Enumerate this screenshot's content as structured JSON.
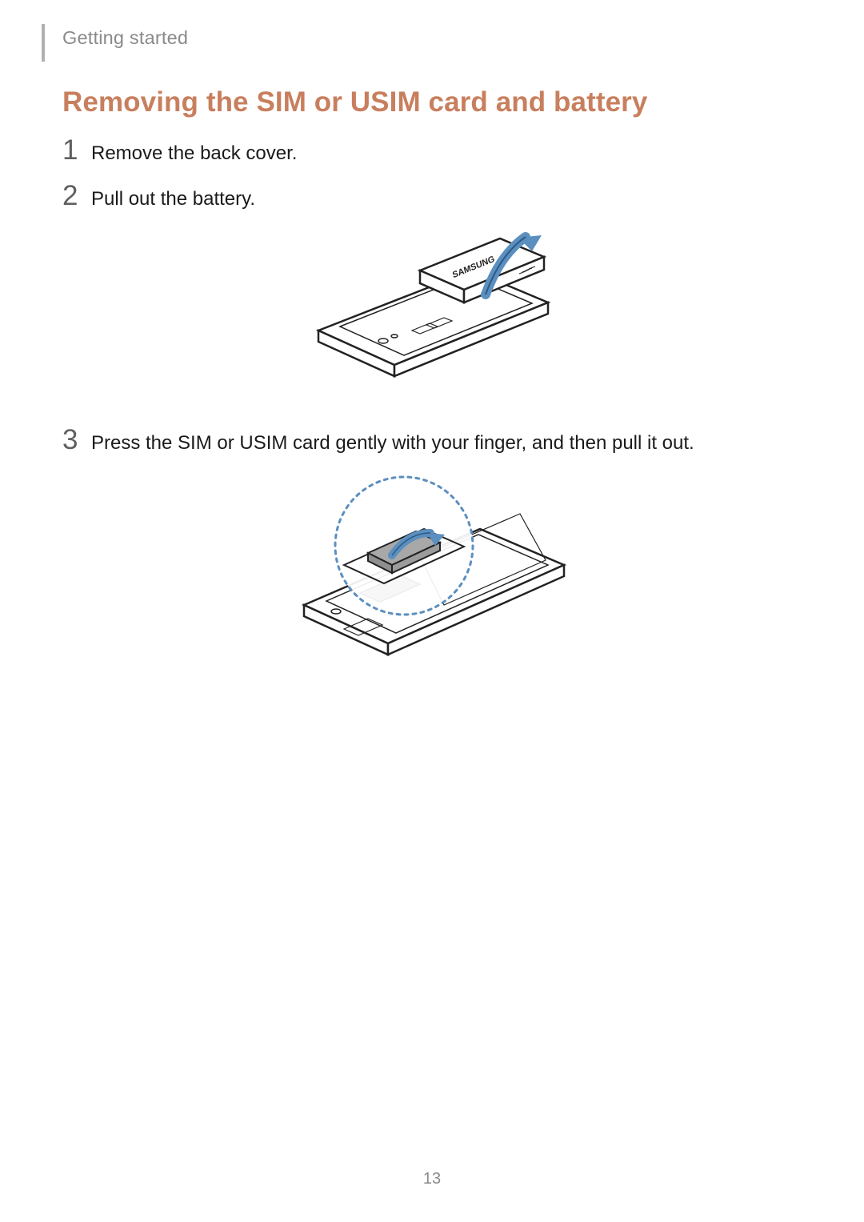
{
  "header": {
    "breadcrumb": "Getting started"
  },
  "section": {
    "title": "Removing the SIM or USIM card and battery"
  },
  "steps": [
    {
      "num": "1",
      "text": "Remove the back cover."
    },
    {
      "num": "2",
      "text": "Pull out the battery."
    },
    {
      "num": "3",
      "text": "Press the SIM or USIM card gently with your finger, and then pull it out."
    }
  ],
  "page_number": "13",
  "illustrations": {
    "battery_alt": "battery-removal-diagram",
    "sim_alt": "sim-removal-diagram"
  }
}
